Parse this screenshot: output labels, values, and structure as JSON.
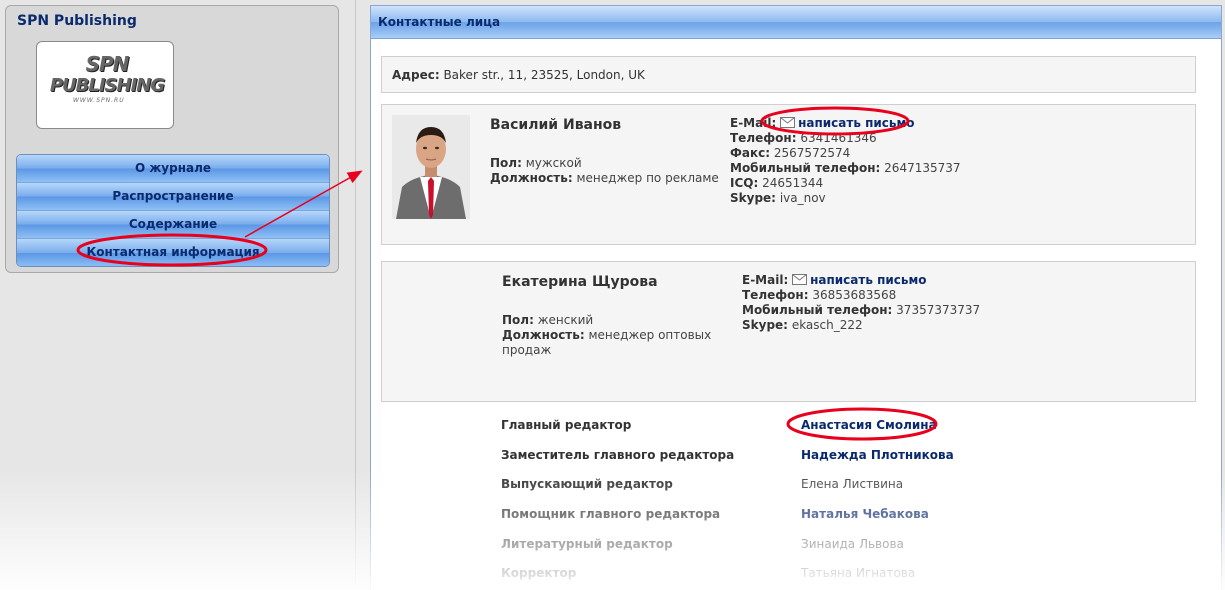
{
  "sidebar": {
    "title": "SPN Publishing",
    "logo": {
      "line1": "SPN",
      "line2": "PUBLISHING",
      "url": "WWW.SPN.RU"
    },
    "menu": [
      {
        "label": "О журнале"
      },
      {
        "label": "Распространение"
      },
      {
        "label": "Содержание"
      },
      {
        "label": "Контактная информация"
      }
    ]
  },
  "main": {
    "header": "Контактные лица",
    "address": {
      "label": "Адрес:",
      "value": "Baker str., 11, 23525, London, UK"
    },
    "contacts": [
      {
        "name": "Василий Иванов",
        "gender_label": "Пол:",
        "gender": "мужской",
        "position_label": "Должность:",
        "position": "менеджер по рекламе",
        "email_label": "E-Mail:",
        "email_link": "написать письмо",
        "phone_label": "Телефон:",
        "phone": "6341461346",
        "fax_label": "Факс:",
        "fax": "2567572574",
        "mobile_label": "Мобильный телефон:",
        "mobile": "2647135737",
        "icq_label": "ICQ:",
        "icq": "24651344",
        "skype_label": "Skype:",
        "skype": "iva_nov"
      },
      {
        "name": "Екатерина Щурова",
        "gender_label": "Пол:",
        "gender": "женский",
        "position_label": "Должность:",
        "position_line1": "менеджер оптовых",
        "position_line2": "продаж",
        "email_label": "E-Mail:",
        "email_link": "написать письмо",
        "phone_label": "Телефон:",
        "phone": "36853683568",
        "mobile_label": "Мобильный телефон:",
        "mobile": "37357373737",
        "skype_label": "Skype:",
        "skype": "ekasch_222"
      }
    ],
    "staff": [
      {
        "role": "Главный редактор",
        "name": "Анастасия Смолина",
        "linked": true
      },
      {
        "role": "Заместитель главного редактора",
        "name": "Надежда Плотникова",
        "linked": true
      },
      {
        "role": "Выпускающий редактор",
        "name": "Елена Листвина",
        "linked": false
      },
      {
        "role": "Помощник главного редактора",
        "name": "Наталья Чебакова",
        "linked": true
      },
      {
        "role": "Литературный редактор",
        "name": "Зинаида Львова",
        "linked": false
      },
      {
        "role": "Корректор",
        "name": "Татьяна Игнатова",
        "linked": false
      }
    ]
  },
  "colors": {
    "link": "#0b2a6e",
    "annotation": "#e8001c",
    "menu_blue": "#79acec"
  }
}
